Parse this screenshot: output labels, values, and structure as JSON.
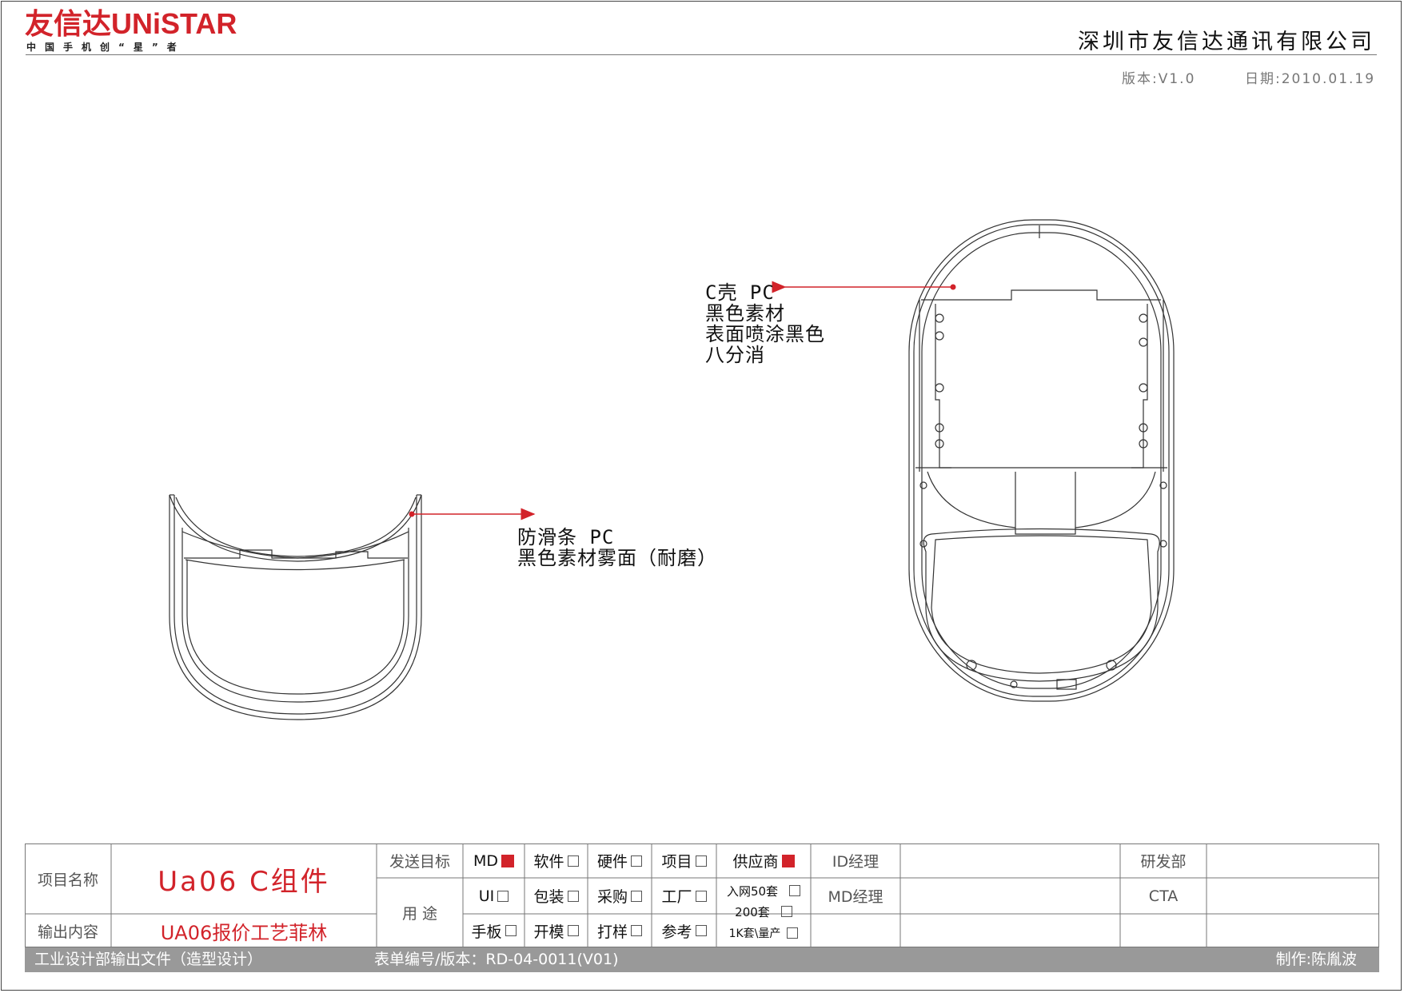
{
  "header": {
    "logo_text": "友信达UNiSTAR",
    "logo_slogan": "中国手机创“星”者",
    "company": "深圳市友信达通讯有限公司",
    "version": "版本:V1.0",
    "date": "日期:2010.01.19"
  },
  "callouts": {
    "c_shell": [
      "C壳 PC",
      "黑色素材",
      "表面喷涂黑色",
      "八分消"
    ],
    "anti_slip": [
      "防滑条 PC",
      "黑色素材雾面（耐磨）"
    ]
  },
  "title_block": {
    "project_name_label": "项目名称",
    "project_name_value": "Ua06 C组件",
    "output_label": "输出内容",
    "output_value": "UA06报价工艺菲林",
    "send_target_label": "发送目标",
    "usage_label": "用 途",
    "checks": {
      "md": "MD",
      "software": "软件",
      "hardware": "硬件",
      "project": "项目",
      "supplier": "供应商",
      "ui": "UI",
      "packaging": "包装",
      "purchase": "采购",
      "factory": "工厂",
      "hand_sample": "手板",
      "mold": "开模",
      "proof": "打样",
      "reference": "参考"
    },
    "quantities": {
      "net50": "入网50套",
      "q200": "200套",
      "q1k": "1K套\\量产"
    },
    "id_manager": "ID经理",
    "md_manager": "MD经理",
    "rd_dept": "研发部",
    "cta": "CTA"
  },
  "footer": {
    "dept_output": "工业设计部输出文件（造型设计）",
    "form_no": "表单编号/版本：RD-04-0011(V01)",
    "author": "制作:陈胤波"
  },
  "colors": {
    "accent_red": "#d2232a",
    "footer_gray": "#999999"
  }
}
